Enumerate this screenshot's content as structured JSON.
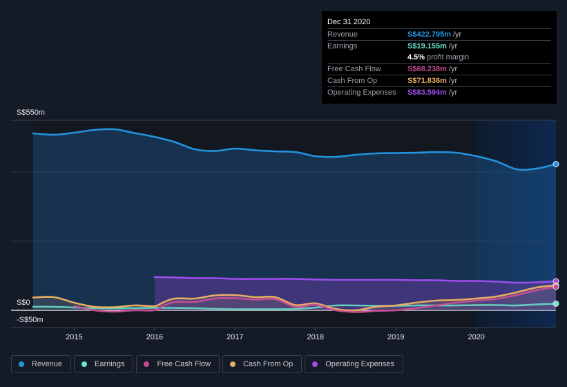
{
  "tooltip": {
    "date": "Dec 31 2020",
    "rows": [
      {
        "label": "Revenue",
        "value": "S$422.795m",
        "unit": "/yr",
        "color": "#2394df"
      },
      {
        "label": "Earnings",
        "value": "S$19.155m",
        "unit": "/yr",
        "color": "#6ce5cf"
      },
      {
        "label": "Free Cash Flow",
        "value": "S$68.238m",
        "unit": "/yr",
        "color": "#c64e92"
      },
      {
        "label": "Cash From Op",
        "value": "S$71.836m",
        "unit": "/yr",
        "color": "#e8ad62"
      },
      {
        "label": "Operating Expenses",
        "value": "S$83.594m",
        "unit": "/yr",
        "color": "#9d4ded"
      }
    ],
    "profit_margin": {
      "pct": "4.5%",
      "text": "profit margin"
    }
  },
  "legend": [
    {
      "label": "Revenue",
      "color": "#2394df"
    },
    {
      "label": "Earnings",
      "color": "#6ce5cf"
    },
    {
      "label": "Free Cash Flow",
      "color": "#c64e92"
    },
    {
      "label": "Cash From Op",
      "color": "#e8ad62"
    },
    {
      "label": "Operating Expenses",
      "color": "#9d4ded"
    }
  ],
  "chart_data": {
    "type": "line",
    "title": "",
    "xlabel": "",
    "ylabel": "",
    "y_tick_labels": [
      "S$550m",
      "S$0",
      "-S$50m"
    ],
    "ylim": [
      -50,
      550
    ],
    "xlim": [
      2014.49,
      2020.99
    ],
    "x_ticks": [
      2015,
      2016,
      2017,
      2018,
      2019,
      2020
    ],
    "x_tick_labels": [
      "2015",
      "2016",
      "2017",
      "2018",
      "2019",
      "2020"
    ],
    "highlight_from": 2020.0,
    "grid": true,
    "legend_position": "bottom",
    "series": [
      {
        "name": "Revenue",
        "color": "#2394df",
        "fill": true,
        "x": [
          2014.49,
          2014.75,
          2015.0,
          2015.25,
          2015.5,
          2015.75,
          2016.0,
          2016.25,
          2016.5,
          2016.75,
          2017.0,
          2017.25,
          2017.5,
          2017.75,
          2018.0,
          2018.25,
          2018.5,
          2018.75,
          2019.0,
          2019.25,
          2019.5,
          2019.75,
          2020.0,
          2020.25,
          2020.5,
          2020.75,
          2020.99
        ],
        "values": [
          512,
          508,
          514,
          522,
          524,
          513,
          502,
          487,
          466,
          461,
          468,
          463,
          460,
          458,
          446,
          444,
          450,
          454,
          455,
          456,
          458,
          456,
          446,
          431,
          408,
          410,
          423
        ]
      },
      {
        "name": "Earnings",
        "color": "#6ce5cf",
        "fill": false,
        "x": [
          2014.49,
          2014.75,
          2015.0,
          2015.25,
          2015.5,
          2015.75,
          2016.0,
          2016.25,
          2016.5,
          2016.75,
          2017.0,
          2017.25,
          2017.5,
          2017.75,
          2018.0,
          2018.25,
          2018.5,
          2018.75,
          2019.0,
          2019.25,
          2019.5,
          2019.75,
          2020.0,
          2020.25,
          2020.5,
          2020.75,
          2020.99
        ],
        "values": [
          10,
          10,
          8,
          6,
          6,
          6,
          7,
          7,
          6,
          4,
          3,
          3,
          3,
          4,
          8,
          14,
          14,
          13,
          13,
          14,
          14,
          14,
          15,
          15,
          14,
          17,
          19
        ]
      },
      {
        "name": "Free Cash Flow",
        "color": "#c64e92",
        "fill": false,
        "x": [
          2015.0,
          2015.25,
          2015.5,
          2015.75,
          2016.0,
          2016.1,
          2016.25,
          2016.5,
          2016.75,
          2017.0,
          2017.25,
          2017.5,
          2017.75,
          2018.0,
          2018.25,
          2018.5,
          2018.75,
          2019.0,
          2019.25,
          2019.5,
          2019.75,
          2020.0,
          2020.25,
          2020.5,
          2020.75,
          2020.99
        ],
        "values": [
          12,
          0,
          -4,
          0,
          0,
          12,
          24,
          24,
          34,
          35,
          31,
          32,
          10,
          16,
          0,
          -5,
          -2,
          0,
          6,
          14,
          22,
          28,
          33,
          44,
          58,
          68
        ]
      },
      {
        "name": "Cash From Op",
        "color": "#e8ad62",
        "fill": true,
        "x": [
          2014.49,
          2014.75,
          2015.0,
          2015.25,
          2015.5,
          2015.75,
          2016.0,
          2016.1,
          2016.25,
          2016.5,
          2016.75,
          2017.0,
          2017.25,
          2017.5,
          2017.75,
          2018.0,
          2018.25,
          2018.5,
          2018.75,
          2019.0,
          2019.25,
          2019.5,
          2019.75,
          2020.0,
          2020.25,
          2020.5,
          2020.75,
          2020.99
        ],
        "values": [
          37,
          38,
          22,
          10,
          9,
          14,
          12,
          22,
          34,
          34,
          43,
          44,
          38,
          38,
          15,
          20,
          4,
          0,
          10,
          14,
          22,
          28,
          30,
          34,
          40,
          52,
          66,
          72
        ]
      },
      {
        "name": "Operating Expenses",
        "color": "#9d4ded",
        "fill": true,
        "x": [
          2016.0,
          2016.25,
          2016.5,
          2016.75,
          2017.0,
          2017.25,
          2017.5,
          2017.75,
          2018.0,
          2018.25,
          2018.5,
          2018.75,
          2019.0,
          2019.25,
          2019.5,
          2019.75,
          2020.0,
          2020.25,
          2020.5,
          2020.75,
          2020.99
        ],
        "values": [
          96,
          95,
          93,
          93,
          91,
          91,
          91,
          91,
          89,
          88,
          88,
          88,
          88,
          87,
          87,
          85,
          85,
          83,
          80,
          81,
          84
        ]
      }
    ]
  }
}
